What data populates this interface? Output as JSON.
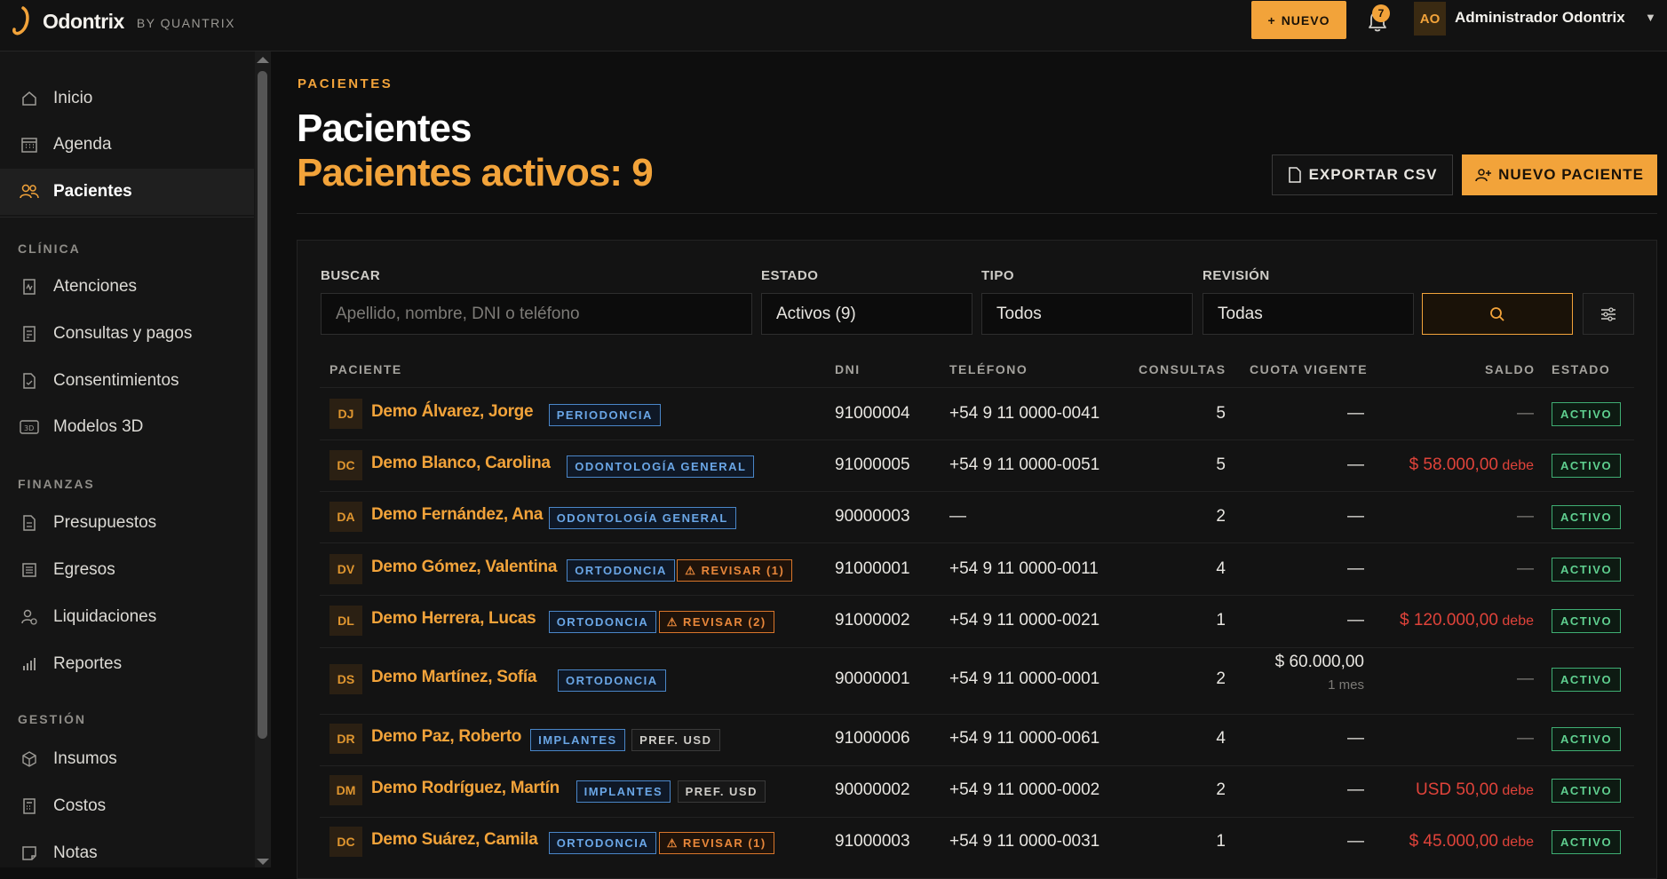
{
  "app": {
    "name": "Odontrix",
    "by": "BY QUANTRIX"
  },
  "topbar": {
    "nuevo_label": "NUEVO",
    "notifications": "7",
    "user_initials": "AO",
    "user_name": "Administrador Odontrix"
  },
  "sidebar": {
    "items": [
      {
        "label": "Inicio",
        "icon": "home-icon"
      },
      {
        "label": "Agenda",
        "icon": "calendar-icon"
      },
      {
        "label": "Pacientes",
        "icon": "users-icon"
      }
    ],
    "clinica_title": "CLÍNICA",
    "clinica": [
      {
        "label": "Atenciones",
        "icon": "clipboard-icon"
      },
      {
        "label": "Consultas y pagos",
        "icon": "receipt-icon"
      },
      {
        "label": "Consentimientos",
        "icon": "document-check-icon"
      },
      {
        "label": "Modelos 3D",
        "icon": "3d-icon"
      }
    ],
    "finanzas_title": "FINANZAS",
    "finanzas": [
      {
        "label": "Presupuestos",
        "icon": "document-icon"
      },
      {
        "label": "Egresos",
        "icon": "ledger-icon"
      },
      {
        "label": "Liquidaciones",
        "icon": "user-money-icon"
      },
      {
        "label": "Reportes",
        "icon": "bar-chart-icon"
      }
    ],
    "gestion_title": "GESTIÓN",
    "gestion": [
      {
        "label": "Insumos",
        "icon": "box-icon"
      },
      {
        "label": "Costos",
        "icon": "calculator-icon"
      },
      {
        "label": "Notas",
        "icon": "note-icon"
      }
    ]
  },
  "page": {
    "breadcrumb": "PACIENTES",
    "title": "Pacientes",
    "subtitle": "Pacientes activos: 9",
    "export_label": "EXPORTAR CSV",
    "new_patient_label": "NUEVO PACIENTE"
  },
  "filters": {
    "buscar_label": "BUSCAR",
    "buscar_placeholder": "Apellido, nombre, DNI o teléfono",
    "estado_label": "ESTADO",
    "estado_value": "Activos (9)",
    "tipo_label": "TIPO",
    "tipo_value": "Todos",
    "revision_label": "REVISIÓN",
    "revision_value": "Todas"
  },
  "table": {
    "headers": [
      "PACIENTE",
      "DNI",
      "TELÉFONO",
      "CONSULTAS",
      "CUOTA VIGENTE",
      "SALDO",
      "ESTADO"
    ],
    "rows": [
      {
        "initials": "DJ",
        "name": "Demo Álvarez, Jorge",
        "tags": [
          {
            "text": "PERIODONCIA",
            "kind": "blue"
          }
        ],
        "dni": "91000004",
        "phone": "+54 9 11 0000-0041",
        "consultas": "5",
        "cuota": "—",
        "cuota_sub": "",
        "saldo": "—",
        "saldo_suffix": "",
        "estado": "ACTIVO"
      },
      {
        "initials": "DC",
        "name": "Demo Blanco, Carolina",
        "tags": [
          {
            "text": "ODONTOLOGÍA GENERAL",
            "kind": "blue"
          }
        ],
        "dni": "91000005",
        "phone": "+54 9 11 0000-0051",
        "consultas": "5",
        "cuota": "—",
        "cuota_sub": "",
        "saldo": "$ 58.000,00",
        "saldo_suffix": "debe",
        "estado": "ACTIVO"
      },
      {
        "initials": "DA",
        "name": "Demo Fernández, Ana",
        "tags": [
          {
            "text": "ODONTOLOGÍA GENERAL",
            "kind": "blue"
          }
        ],
        "dni": "90000003",
        "phone": "—",
        "consultas": "2",
        "cuota": "—",
        "cuota_sub": "",
        "saldo": "—",
        "saldo_suffix": "",
        "estado": "ACTIVO"
      },
      {
        "initials": "DV",
        "name": "Demo Gómez, Valentina",
        "tags": [
          {
            "text": "ORTODONCIA",
            "kind": "blue"
          },
          {
            "text": "⚠ REVISAR (1)",
            "kind": "warn"
          }
        ],
        "dni": "91000001",
        "phone": "+54 9 11 0000-0011",
        "consultas": "4",
        "cuota": "—",
        "cuota_sub": "",
        "saldo": "—",
        "saldo_suffix": "",
        "estado": "ACTIVO"
      },
      {
        "initials": "DL",
        "name": "Demo Herrera, Lucas",
        "tags": [
          {
            "text": "ORTODONCIA",
            "kind": "blue"
          },
          {
            "text": "⚠ REVISAR (2)",
            "kind": "warn"
          }
        ],
        "dni": "91000002",
        "phone": "+54 9 11 0000-0021",
        "consultas": "1",
        "cuota": "—",
        "cuota_sub": "",
        "saldo": "$ 120.000,00",
        "saldo_suffix": "debe",
        "estado": "ACTIVO"
      },
      {
        "initials": "DS",
        "name": "Demo Martínez, Sofía",
        "tags": [
          {
            "text": "ORTODONCIA",
            "kind": "blue"
          }
        ],
        "dni": "90000001",
        "phone": "+54 9 11 0000-0001",
        "consultas": "2",
        "cuota": "$ 60.000,00",
        "cuota_sub": "1 mes",
        "saldo": "—",
        "saldo_suffix": "",
        "estado": "ACTIVO"
      },
      {
        "initials": "DR",
        "name": "Demo Paz, Roberto",
        "tags": [
          {
            "text": "IMPLANTES",
            "kind": "blue"
          },
          {
            "text": "PREF. USD",
            "kind": "gray"
          }
        ],
        "dni": "91000006",
        "phone": "+54 9 11 0000-0061",
        "consultas": "4",
        "cuota": "—",
        "cuota_sub": "",
        "saldo": "—",
        "saldo_suffix": "",
        "estado": "ACTIVO"
      },
      {
        "initials": "DM",
        "name": "Demo Rodríguez, Martín",
        "tags": [
          {
            "text": "IMPLANTES",
            "kind": "blue"
          },
          {
            "text": "PREF. USD",
            "kind": "gray"
          }
        ],
        "dni": "90000002",
        "phone": "+54 9 11 0000-0002",
        "consultas": "2",
        "cuota": "—",
        "cuota_sub": "",
        "saldo": "USD 50,00",
        "saldo_suffix": "debe",
        "estado": "ACTIVO"
      },
      {
        "initials": "DC",
        "name": "Demo Suárez, Camila",
        "tags": [
          {
            "text": "ORTODONCIA",
            "kind": "blue"
          },
          {
            "text": "⚠ REVISAR (1)",
            "kind": "warn"
          }
        ],
        "dni": "91000003",
        "phone": "+54 9 11 0000-0031",
        "consultas": "1",
        "cuota": "—",
        "cuota_sub": "",
        "saldo": "$ 45.000,00",
        "saldo_suffix": "debe",
        "estado": "ACTIVO"
      }
    ]
  },
  "colors": {
    "accent": "#f2a33a",
    "active_status": "#5fcf8f",
    "debt": "#e0433a",
    "tag_blue": "#6aa6e6",
    "tag_warn": "#e8873a"
  }
}
